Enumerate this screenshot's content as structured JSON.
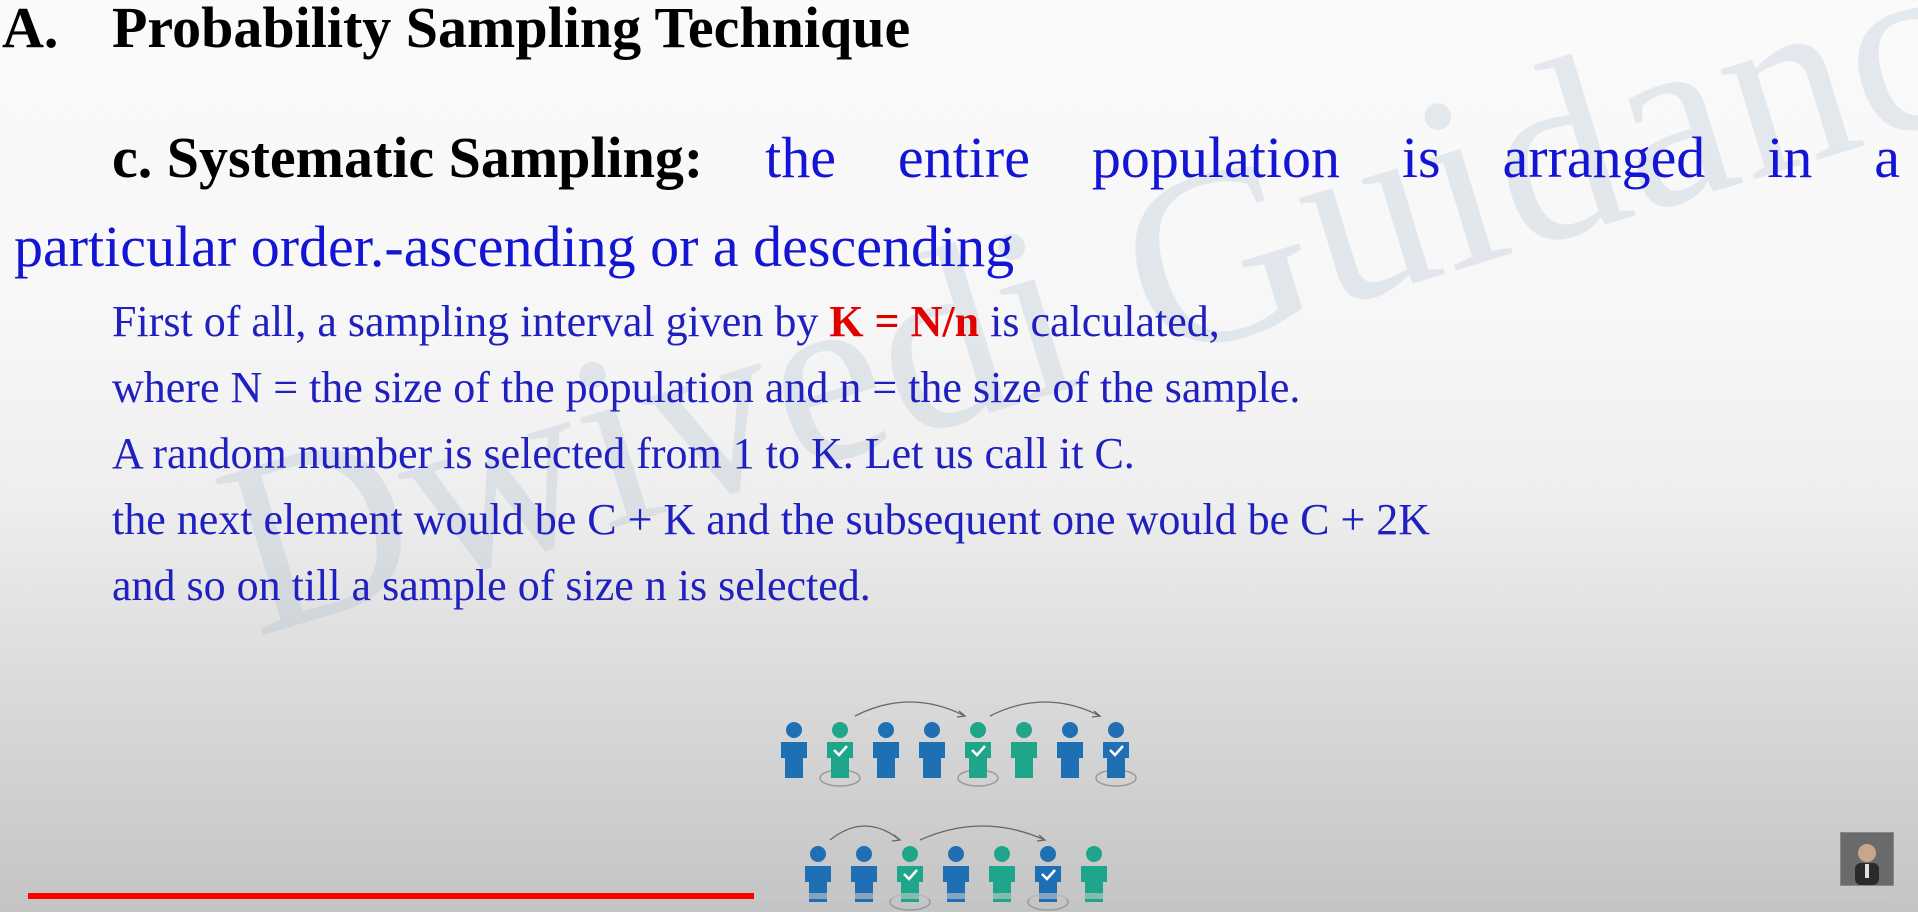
{
  "slide": {
    "heading": {
      "letter": "A.",
      "title": "Probability Sampling Technique"
    },
    "subheading": {
      "label": "c. Systematic Sampling:",
      "words_line1": [
        "the",
        "entire",
        "population",
        "is",
        "arranged",
        "in",
        "a"
      ],
      "line2": "particular order.-ascending or a descending"
    },
    "body": {
      "line1_before": "First of all, a sampling interval given by ",
      "line1_formula": "K = N/n",
      "line1_after": " is calculated,",
      "line2": "where N = the size of the population and n = the size of the sample.",
      "line3": "A random number is selected from 1 to K. Let us call it C.",
      "line4": "the next element would be C + K and the subsequent one would be C + 2K",
      "line5": "and so on till a sample of size n is selected."
    },
    "watermark": "Dwivedi Guidance",
    "illustration": {
      "row1_colors": [
        "#1f6fb5",
        "#1fa58a",
        "#1f6fb5",
        "#1f6fb5",
        "#1fa58a",
        "#1fa58a",
        "#1f6fb5",
        "#1f6fb5"
      ],
      "row1_checked": [
        false,
        true,
        false,
        false,
        true,
        false,
        false,
        true
      ],
      "row2_colors": [
        "#1f6fb5",
        "#1f6fb5",
        "#1fa58a",
        "#1f6fb5",
        "#1fa58a",
        "#1f6fb5",
        "#1fa58a"
      ],
      "row2_checked": [
        false,
        false,
        true,
        false,
        false,
        true,
        false
      ]
    }
  },
  "player": {
    "progress_fraction": 0.39
  },
  "colors": {
    "blue_text": "#1414d4",
    "body_text": "#2020c0",
    "formula": "#e00000",
    "progress": "#ff0000"
  }
}
